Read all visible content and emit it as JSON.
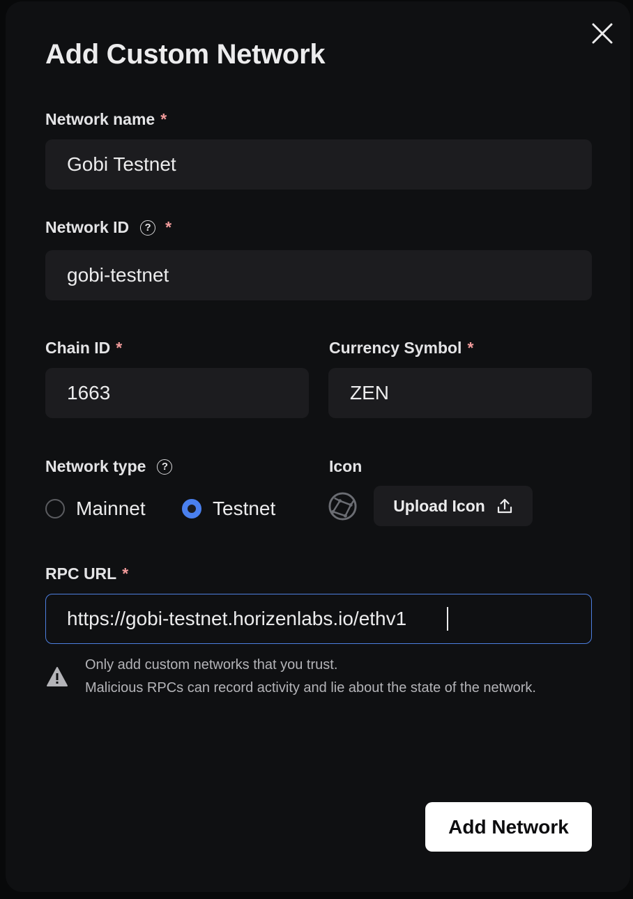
{
  "dialog": {
    "title": "Add Custom Network",
    "close_icon": "close-icon"
  },
  "fields": {
    "network_name": {
      "label": "Network name",
      "required_mark": "*",
      "value": "Gobi Testnet"
    },
    "network_id": {
      "label": "Network ID",
      "help_icon": "help-circle-icon",
      "help_glyph": "?",
      "required_mark": "*",
      "value": "gobi-testnet"
    },
    "chain_id": {
      "label": "Chain ID",
      "required_mark": "*",
      "value": "1663"
    },
    "currency_symbol": {
      "label": "Currency Symbol",
      "required_mark": "*",
      "value": "ZEN"
    },
    "network_type": {
      "label": "Network type",
      "help_icon": "help-circle-icon",
      "help_glyph": "?",
      "options": [
        {
          "label": "Mainnet",
          "checked": false
        },
        {
          "label": "Testnet",
          "checked": true
        }
      ]
    },
    "icon": {
      "label": "Icon",
      "placeholder_icon": "globe-network-icon",
      "upload_label": "Upload Icon",
      "upload_icon": "upload-icon"
    },
    "rpc_url": {
      "label": "RPC URL",
      "required_mark": "*",
      "value": "https://gobi-testnet.horizenlabs.io/ethv1",
      "focused": true
    }
  },
  "warning": {
    "icon": "warning-triangle-icon",
    "line1": "Only add custom networks that you trust.",
    "line2": "Malicious RPCs can record activity and lie about the state of the network."
  },
  "actions": {
    "submit_label": "Add Network"
  },
  "colors": {
    "accent": "#4a80ee",
    "required": "#f29b9b",
    "background": "#0f1012",
    "input_bg": "#1c1c1f"
  }
}
